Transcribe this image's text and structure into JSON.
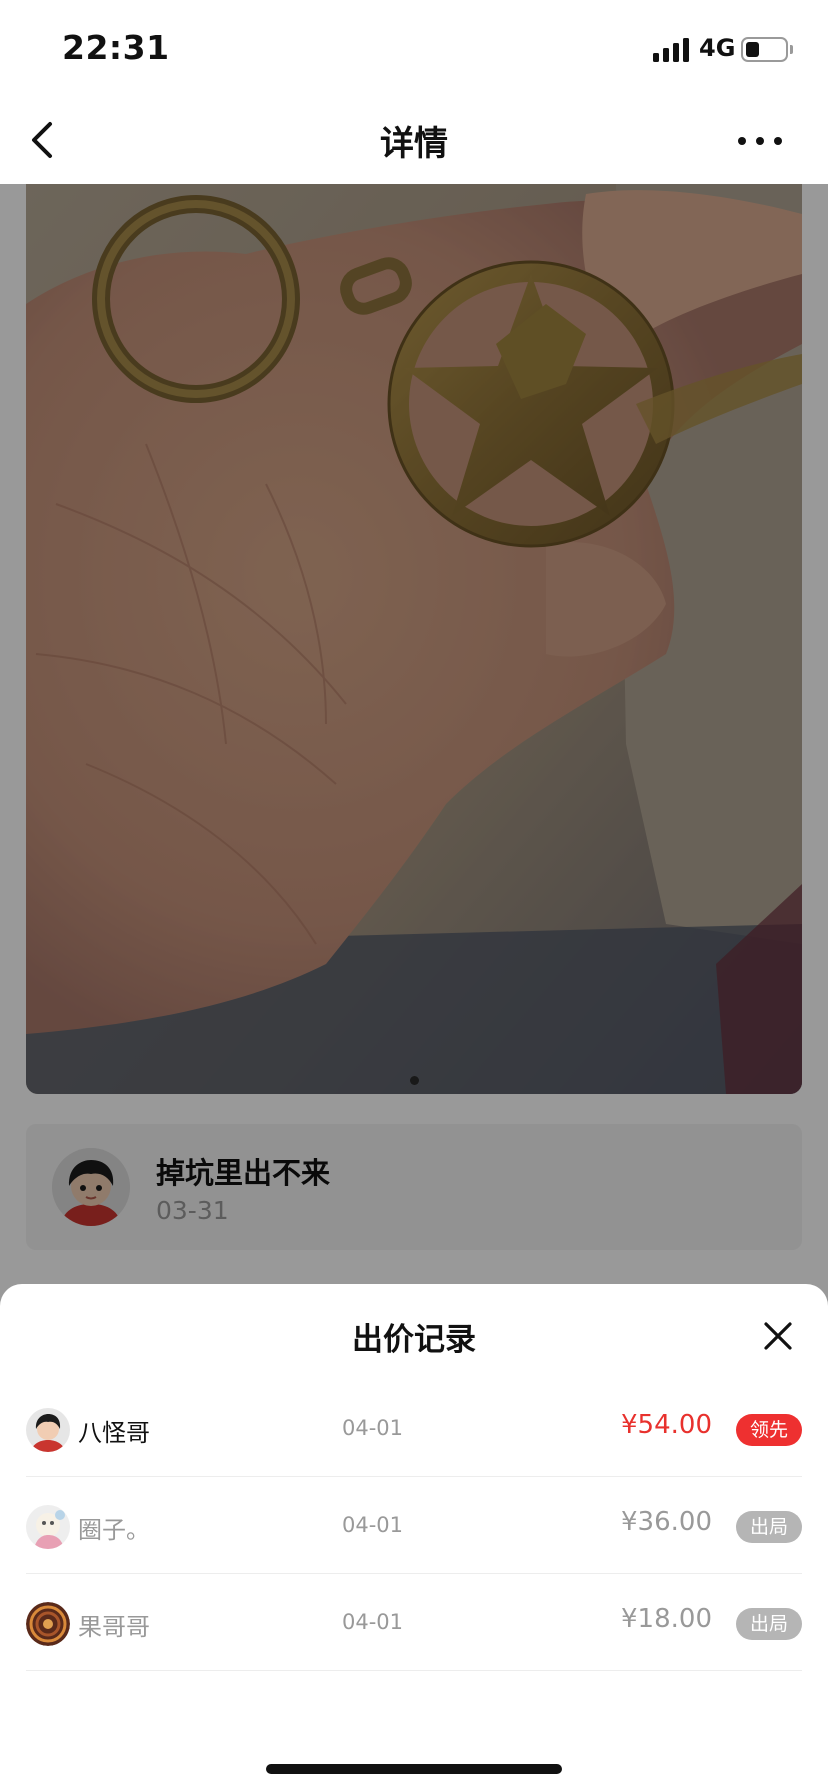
{
  "status_bar": {
    "time": "22:31",
    "network": "4G",
    "battery_icon": "battery-icon",
    "signal_icon": "signal-icon"
  },
  "nav": {
    "title": "详情",
    "back_icon": "chevron-left-icon",
    "more_icon": "more-dots-icon"
  },
  "gallery": {
    "page_count": 1,
    "current_page": 1
  },
  "seller": {
    "name": "掉坑里出不来",
    "date": "03-31"
  },
  "bid_sheet": {
    "title": "出价记录",
    "close_icon": "close-icon",
    "bids": [
      {
        "name": "八怪哥",
        "date": "04-01",
        "price": "¥54.00",
        "status": "领先"
      },
      {
        "name": "圈子。",
        "date": "04-01",
        "price": "¥36.00",
        "status": "出局"
      },
      {
        "name": "果哥哥",
        "date": "04-01",
        "price": "¥18.00",
        "status": "出局"
      }
    ]
  },
  "colors": {
    "price_leading": "#e8312d",
    "badge_leading": "#ee3030",
    "badge_out": "#b5b5b5",
    "muted_text": "#999999",
    "overlay": "rgba(0,0,0,0.40)"
  }
}
